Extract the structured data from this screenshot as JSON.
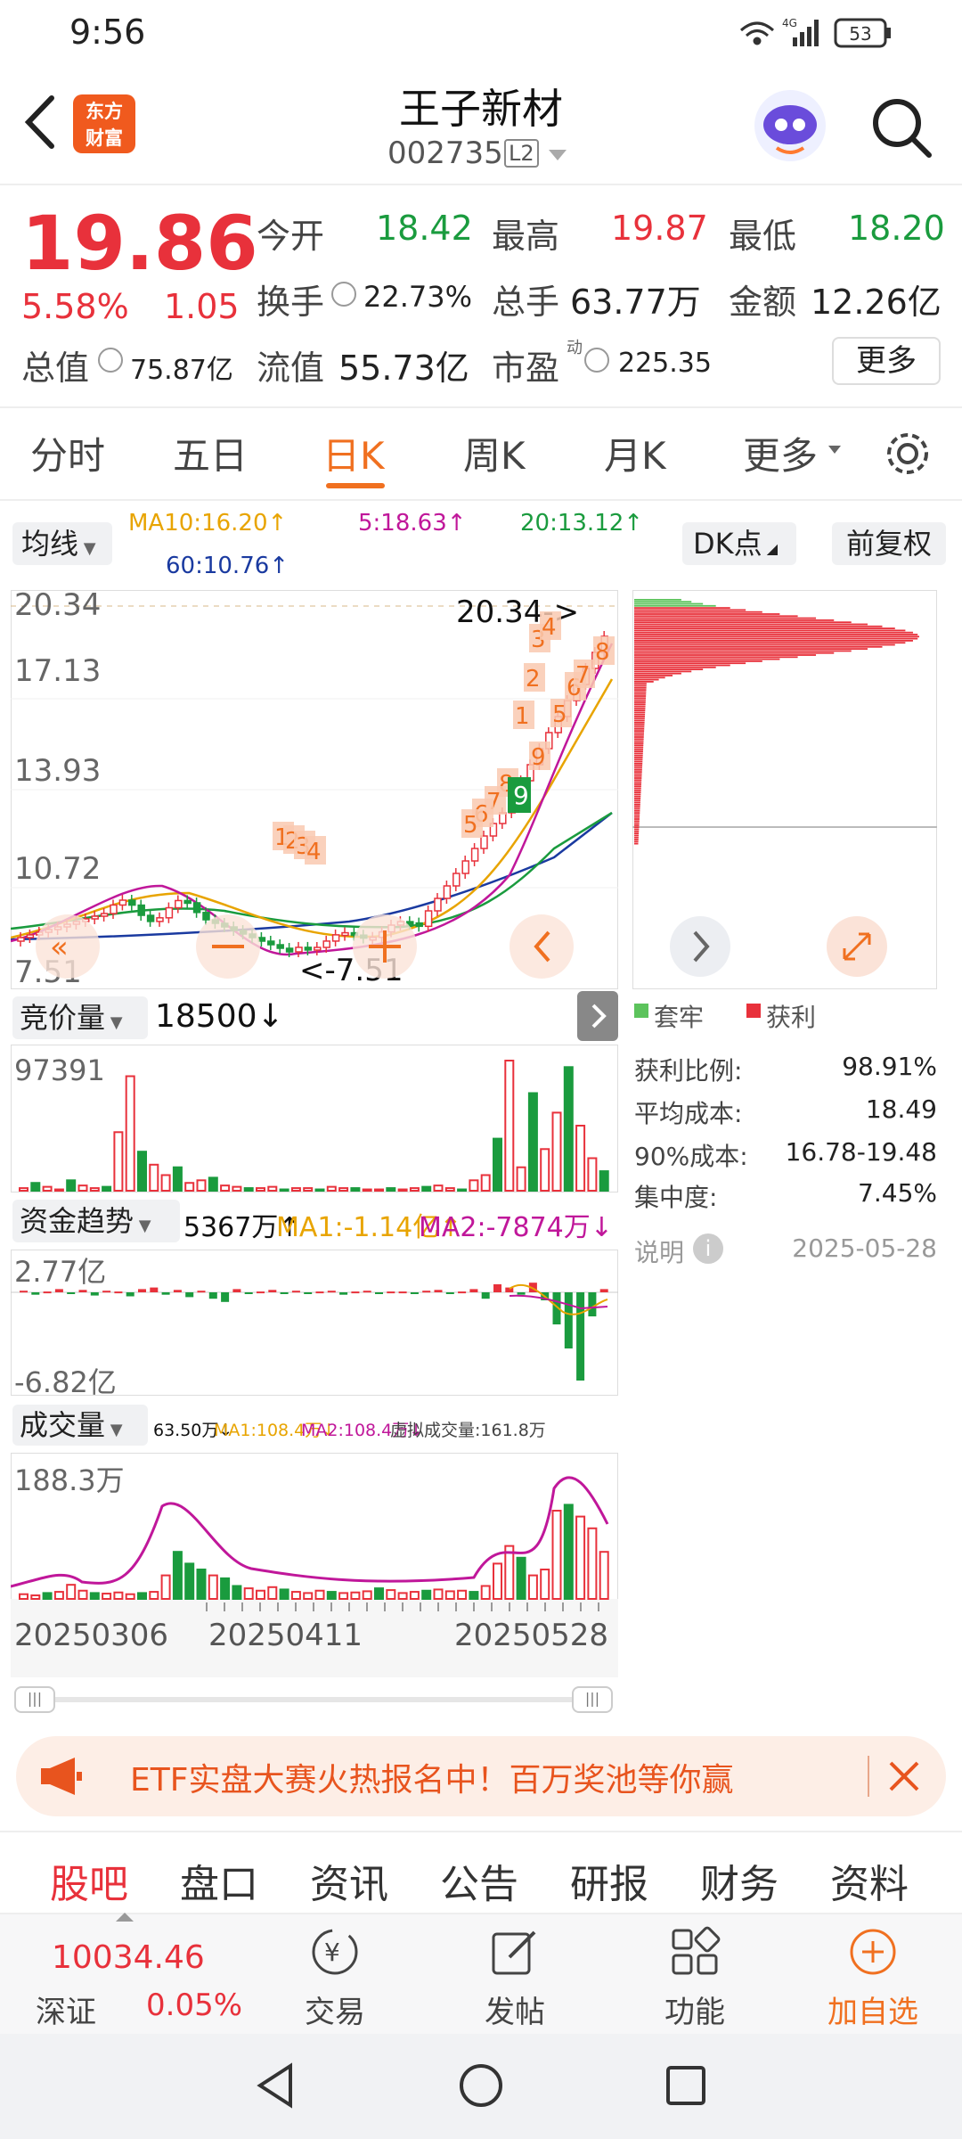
{
  "status_bar": {
    "time": "9:56",
    "net": "4G",
    "battery": "53"
  },
  "header": {
    "name": "王子新材",
    "code": "002735",
    "level": "L2",
    "logo_line1": "东方",
    "logo_line2": "财富"
  },
  "quote": {
    "price": "19.86",
    "pct": "5.58%",
    "change": "1.05",
    "open_label": "今开",
    "open": "18.42",
    "high_label": "最高",
    "high": "19.87",
    "low_label": "最低",
    "low": "18.20",
    "turnover_label": "换手",
    "turnover": "22.73%",
    "volume_label": "总手",
    "volume": "63.77万",
    "amount_label": "金额",
    "amount": "12.26亿",
    "mktcap_label": "总值",
    "mktcap": "75.87亿",
    "float_label": "流值",
    "float": "55.73亿",
    "pe_label": "市盈",
    "pe_sup": "动",
    "pe": "225.35",
    "more": "更多"
  },
  "tabs": [
    "分时",
    "五日",
    "日K",
    "周K",
    "月K",
    "更多"
  ],
  "chart_controls": {
    "ma_select": "均线",
    "ma10": "MA10:16.20↑",
    "ma5": "5:18.63↑",
    "ma20": "20:13.12↑",
    "ma60": "60:10.76↑",
    "dk": "DK点",
    "adjust": "前复权"
  },
  "kline_labels": {
    "y1": "20.34",
    "y2": "17.13",
    "y3": "13.93",
    "y4": "10.72",
    "y5": "7.51",
    "max_mark": "20.34->",
    "min_mark": "<-7.51"
  },
  "dk_marks": [
    "3",
    "4",
    "8",
    "2",
    "6",
    "7",
    "1",
    "5",
    "9",
    "8",
    "7",
    "6",
    "5",
    "1",
    "2",
    "3",
    "4"
  ],
  "chip": {
    "legend_trap": "套牢",
    "legend_profit": "获利",
    "rows": [
      {
        "label": "获利比例:",
        "value": "98.91%"
      },
      {
        "label": "平均成本:",
        "value": "18.49"
      },
      {
        "label": "90%成本:",
        "value": "16.78-19.48"
      },
      {
        "label": "集中度:",
        "value": "7.45%"
      }
    ],
    "note": "说明",
    "date": "2025-05-28"
  },
  "auction": {
    "select": "竞价量",
    "value": "18500↓",
    "max": "97391"
  },
  "fund": {
    "select": "资金趋势",
    "value": "5367万↑",
    "ma1": "MA1:-1.14亿↑",
    "ma2": "MA2:-7874万↓",
    "top": "2.77亿",
    "bottom": "-6.82亿"
  },
  "volume": {
    "select": "成交量",
    "value": "63.50万↓",
    "ma1": "MA1:108.4万↓",
    "ma2": "MA2:108.4万↓",
    "virtual": "虚拟成交量:161.8万",
    "max": "188.3万"
  },
  "dates": [
    "20250306",
    "20250411",
    "20250528"
  ],
  "banner": {
    "text": "ETF实盘大赛火热报名中！百万奖池等你赢"
  },
  "bottom_tabs": [
    "股吧",
    "盘口",
    "资讯",
    "公告",
    "研报",
    "财务",
    "资料"
  ],
  "nav": {
    "index_value": "10034.46",
    "index_name": "深证",
    "index_pct": "0.05%",
    "trade": "交易",
    "post": "发帖",
    "func": "功能",
    "watch": "加自选"
  },
  "colors": {
    "up": "#e8313b",
    "down": "#1a9b3e",
    "accent": "#f07020"
  }
}
